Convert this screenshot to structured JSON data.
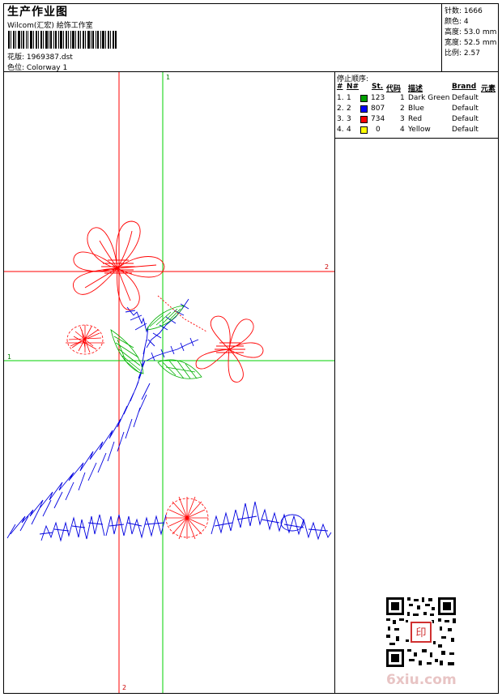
{
  "header": {
    "title": "生产作业图",
    "studio": "Wilcom(汇宏) 絵饰工作室",
    "file_label": "花版:",
    "file_value": "1969387.dst",
    "colorway_label": "色位:",
    "colorway_value": "Colorway 1"
  },
  "stats": [
    {
      "label": "针数:",
      "value": "1666"
    },
    {
      "label": "颜色:",
      "value": "4"
    },
    {
      "label": "高度:",
      "value": "53.0 mm"
    },
    {
      "label": "宽度:",
      "value": "52.5 mm"
    },
    {
      "label": "比例:",
      "value": "2.57"
    }
  ],
  "stop_sequence": {
    "title": "停止顺序:",
    "columns": [
      "#",
      "N#",
      "St.",
      "代码",
      "描述",
      "Brand",
      "元素"
    ],
    "rows": [
      {
        "idx": "1.",
        "n": "1",
        "color": "#00a000",
        "st": "123",
        "code": "1",
        "desc": "Dark Green",
        "brand": "Default"
      },
      {
        "idx": "2.",
        "n": "2",
        "color": "#0000ff",
        "st": "807",
        "code": "2",
        "desc": "Blue",
        "brand": "Default"
      },
      {
        "idx": "3.",
        "n": "3",
        "color": "#ff0000",
        "st": "734",
        "code": "3",
        "desc": "Red",
        "brand": "Default"
      },
      {
        "idx": "4.",
        "n": "4",
        "color": "#ffff00",
        "st": "0",
        "code": "4",
        "desc": "Yellow",
        "brand": "Default"
      }
    ]
  },
  "guides": {
    "green_vertical": "1",
    "green_horizontal": "1",
    "red_horizontal": "2",
    "red_vertical": "2",
    "green_color": "#00d000",
    "red_color": "#ff0000"
  },
  "watermark": "6xiu.com",
  "qr_seal": "印"
}
